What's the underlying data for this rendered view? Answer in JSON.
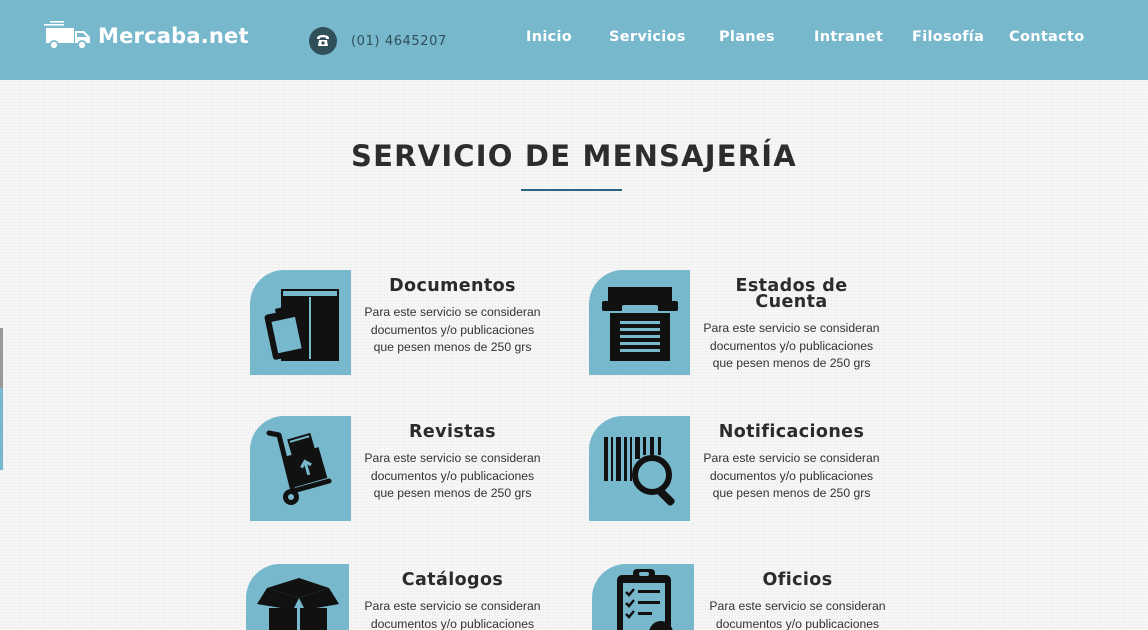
{
  "header": {
    "brand": "Mercaba.net",
    "phone": "(01) 4645207",
    "colors": {
      "header_bg": "#78b8cd",
      "phone_circle": "#2f4f5b",
      "accent_line": "#2a6584"
    },
    "nav": [
      {
        "label": "Inicio"
      },
      {
        "label": "Servicios"
      },
      {
        "label": "Planes"
      },
      {
        "label": "Intranet"
      },
      {
        "label": "Filosofía"
      },
      {
        "label": "Contacto"
      }
    ]
  },
  "page": {
    "title": "SERVICIO DE MENSAJERÍA"
  },
  "services": [
    {
      "title": "Documentos",
      "icon": "documents-box-icon",
      "desc": [
        "Para este servicio se consideran",
        "documentos y/o publicaciones",
        "que pesen menos de 250 grs"
      ]
    },
    {
      "title_lines": [
        "Estados de",
        "Cuenta"
      ],
      "icon": "account-statement-printer-icon",
      "desc": [
        "Para este servicio se consideran",
        "documentos y/o publicaciones",
        "que pesen menos de 250 grs"
      ]
    },
    {
      "title": "Revistas",
      "icon": "hand-truck-icon",
      "desc": [
        "Para este servicio se consideran",
        "documentos y/o publicaciones",
        "que pesen menos de 250 grs"
      ]
    },
    {
      "title": "Notificaciones",
      "icon": "barcode-search-icon",
      "desc": [
        "Para este servicio se consideran",
        "documentos y/o publicaciones",
        "que pesen menos de 250 grs"
      ]
    },
    {
      "title": "Catálogos",
      "icon": "open-box-icon",
      "desc": [
        "Para este servicio se consideran",
        "documentos y/o publicaciones"
      ]
    },
    {
      "title": "Oficios",
      "icon": "clipboard-checklist-icon",
      "desc": [
        "Para este servicio se consideran",
        "documentos y/o publicaciones"
      ]
    }
  ]
}
